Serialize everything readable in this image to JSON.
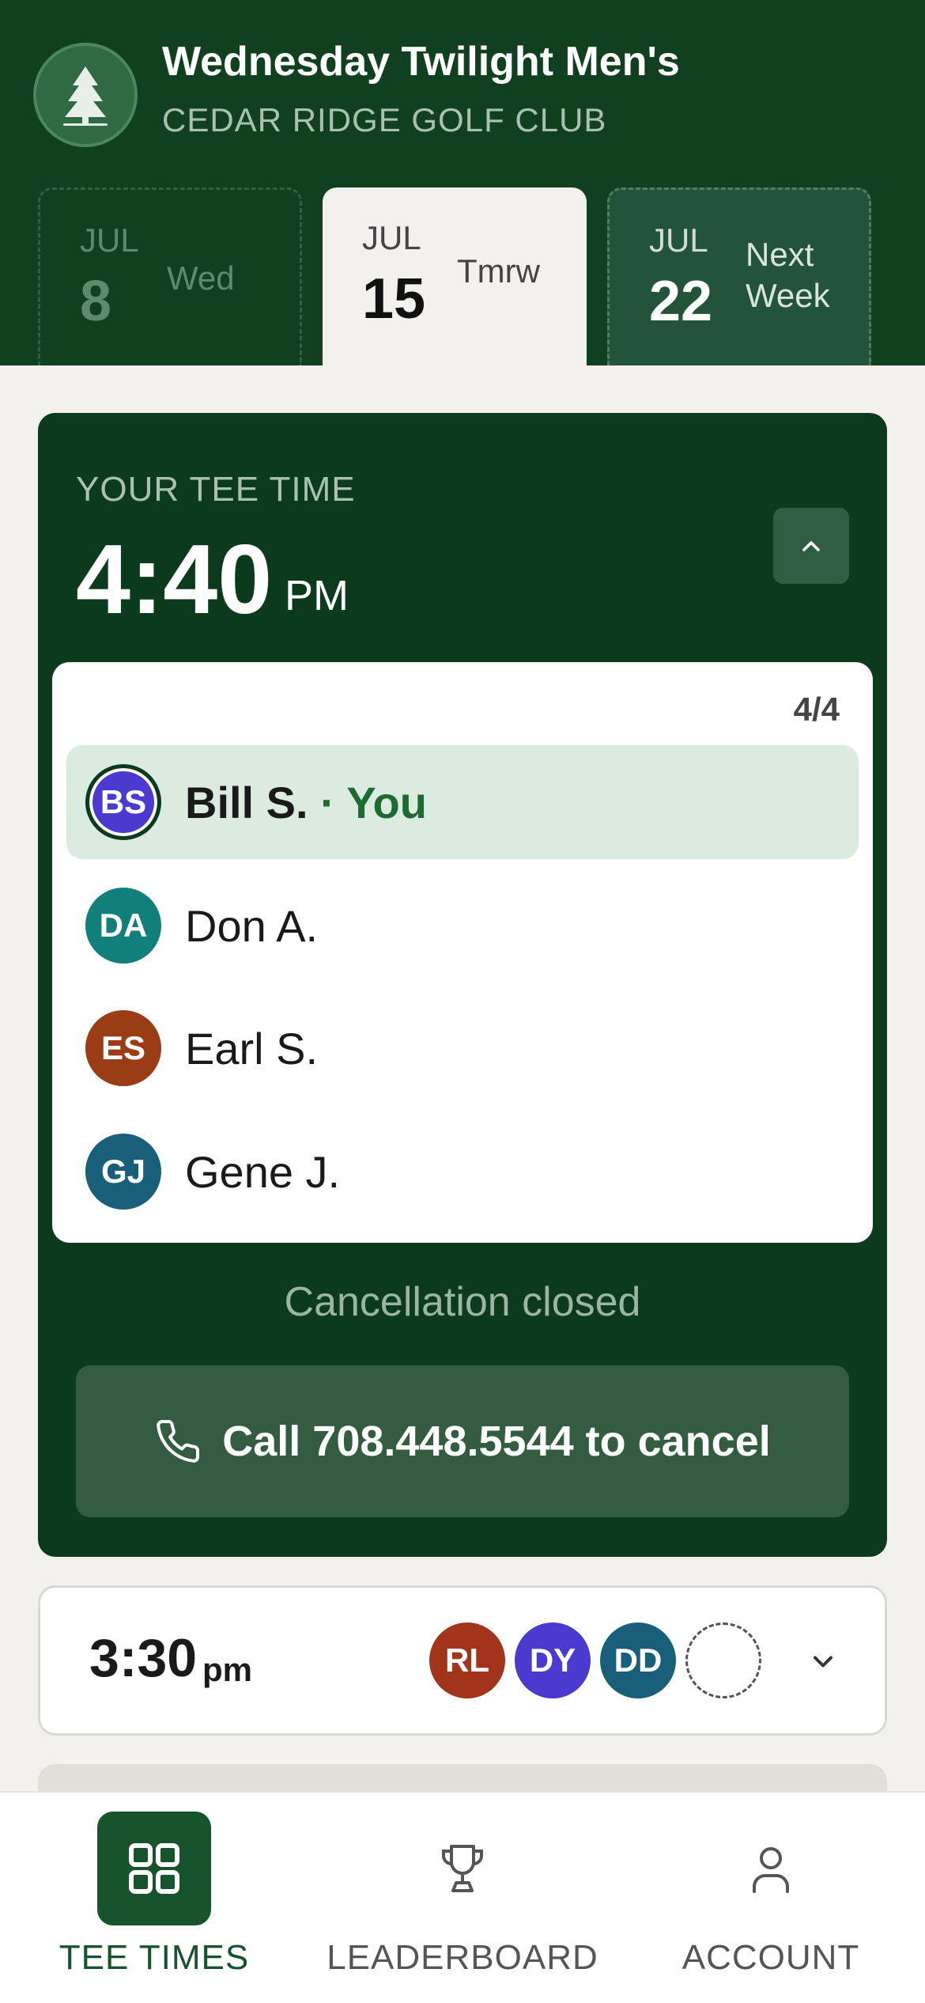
{
  "header": {
    "title": "Wednesday Twilight Men's",
    "subtitle": "CEDAR RIDGE GOLF CLUB",
    "logo_icon": "pine-tree-icon"
  },
  "date_tabs": [
    {
      "month": "JUL",
      "day": "8",
      "label": "Wed",
      "state": "past"
    },
    {
      "month": "JUL",
      "day": "15",
      "label": "Tmrw",
      "state": "selected"
    },
    {
      "month": "JUL",
      "day": "22",
      "label": "Next Week",
      "state": "upcoming"
    }
  ],
  "your_tee_time": {
    "label": "YOUR TEE TIME",
    "time": "4:40",
    "ampm": "PM",
    "player_count": "4/4",
    "players": [
      {
        "initials": "BS",
        "name": "Bill S.",
        "suffix": " · You",
        "color": "#4a3ad0",
        "is_you": true
      },
      {
        "initials": "DA",
        "name": "Don A.",
        "color": "#12807a"
      },
      {
        "initials": "ES",
        "name": "Earl S.",
        "color": "#9a3d16"
      },
      {
        "initials": "GJ",
        "name": "Gene J.",
        "color": "#1a5f7a"
      }
    ],
    "cancellation_status": "Cancellation closed",
    "call_button_label": "Call 708.448.5544 to cancel",
    "call_icon": "phone-icon"
  },
  "other_slots": [
    {
      "time": "3:30",
      "ampm": "pm",
      "players": [
        {
          "initials": "RL",
          "color": "#a3341c"
        },
        {
          "initials": "DY",
          "color": "#4a3ad0"
        },
        {
          "initials": "DD",
          "color": "#1a5f7a"
        }
      ],
      "open_spots": 1
    }
  ],
  "bottom_nav": [
    {
      "label": "TEE TIMES",
      "icon": "grid-icon",
      "active": true
    },
    {
      "label": "LEADERBOARD",
      "icon": "trophy-icon",
      "active": false
    },
    {
      "label": "ACCOUNT",
      "icon": "person-icon",
      "active": false
    }
  ],
  "colors": {
    "header_bg": "#10401f",
    "card_bg": "#0c3a1c",
    "accent": "#1e6a33",
    "page_bg": "#f2f1ee"
  }
}
